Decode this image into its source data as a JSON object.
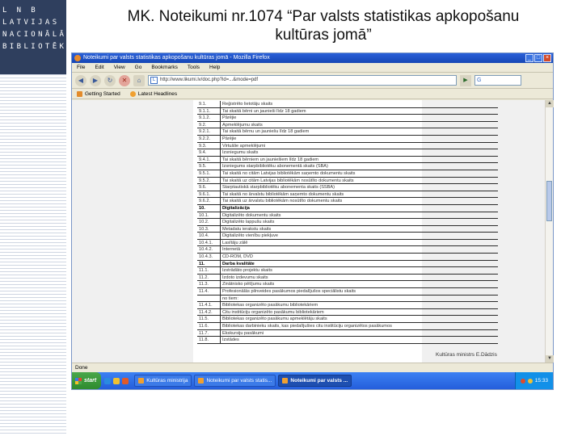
{
  "brand": {
    "lines": [
      "L N B",
      "LATVIJAS",
      "NACIONĀLĀ",
      "BIBLIOTĒKA"
    ]
  },
  "slide": {
    "title_line1": "MK. Noteikumi nr.1074 “Par valsts statistikas apkopošanu",
    "title_line2": "kultūras jomā”"
  },
  "browser": {
    "window_title": "Noteikumi par valsts statistikas apkopošanu kultūras jomā - Mozilla Firefox",
    "menu": [
      "File",
      "Edit",
      "View",
      "Go",
      "Bookmarks",
      "Tools",
      "Help"
    ],
    "url": "http://www.likumi.lv/doc.php?id=...&mode=pdf",
    "search_placeholder": "G",
    "bookmarks": [
      "Getting Started",
      "Latest Headlines"
    ],
    "status": "Done",
    "signature": "Kultūras ministrs E.Dādzis"
  },
  "table_rows": [
    {
      "num": "9.1.",
      "text": "Reģistrēto lietotāju skaits"
    },
    {
      "num": "9.1.1.",
      "text": "Tai skaitā bērni un jaunieši līdz 18 gadiem"
    },
    {
      "num": "9.1.2.",
      "text": "Pārējie"
    },
    {
      "num": "9.2.",
      "text": "Apmeklējumu skaits"
    },
    {
      "num": "9.2.1.",
      "text": "Tai skaitā bērnu un jauniešu līdz 18 gadiem"
    },
    {
      "num": "9.2.2.",
      "text": "Pārējie"
    },
    {
      "num": "9.3.",
      "text": "Virtuālie apmeklējumi"
    },
    {
      "num": "9.4.",
      "text": "Izsniegumu skaits"
    },
    {
      "num": "9.4.1.",
      "text": "Tai skaitā bērniem un jauniešiem līdz 18 gadiem"
    },
    {
      "num": "9.5.",
      "text": "Izsniegums starpbibliotēku abonementā skaits (SBA)"
    },
    {
      "num": "9.5.1.",
      "text": "Tai skaitā no citām Latvijas bibliotēkām saņemto dokumentu skaits"
    },
    {
      "num": "9.5.2.",
      "text": "Tai skaitā uz citām Latvijas bibliotēkām nosūtīto dokumentu skaits"
    },
    {
      "num": "9.6.",
      "text": "Starptautiskā starpbibliotēku abonementa skaits (SSBA)"
    },
    {
      "num": "9.6.1.",
      "text": "Tai skaitā no ārvalstu bibliotēkām saņemto dokumentu skaits"
    },
    {
      "num": "9.6.2.",
      "text": "Tai skaitā uz ārvalstu bibliotēkām nosūtīto dokumentu skaits"
    },
    {
      "num": "10.",
      "text": "Digitalizācija",
      "bold": true
    },
    {
      "num": "10.1.",
      "text": "Digitalizēto dokumentu skaits"
    },
    {
      "num": "10.2.",
      "text": "Digitalizēto lappušu skaits"
    },
    {
      "num": "10.3.",
      "text": "Metadatu ierakstu skaits"
    },
    {
      "num": "10.4.",
      "text": "Digitalizēto vienību piekļuve"
    },
    {
      "num": "10.4.1.",
      "text": "Lasītāju zālē"
    },
    {
      "num": "10.4.2.",
      "text": "Internetā"
    },
    {
      "num": "10.4.3.",
      "text": "CD-ROM, DVD"
    },
    {
      "num": "11.",
      "text": "Darba kvalitāte",
      "bold": true
    },
    {
      "num": "11.1.",
      "text": "Izstrādāto projektu skaits"
    },
    {
      "num": "11.2.",
      "text": "Izdoto izdevumu skaits"
    },
    {
      "num": "11.3.",
      "text": "Zinātnisko pētījumu skaits"
    },
    {
      "num": "11.4.",
      "text": "Profesionālās pilnveides pasākumos piedalījušos speciālistu skaits"
    },
    {
      "num": "",
      "text": "no tiem:"
    },
    {
      "num": "11.4.1.",
      "text": "Bibliotekas organizēto pasākumu bibliotekāriem"
    },
    {
      "num": "11.4.2.",
      "text": "Citu institūciju organizēto pasākumu bibliotekāriem"
    },
    {
      "num": "11.5.",
      "text": "Bibliotekas organizēto pasākumu apmeklētāju skaits"
    },
    {
      "num": "11.6.",
      "text": "Bibliotekas darbinieku skaits, kas piedalījušies citu institūciju organizētos pasākumos"
    },
    {
      "num": "11.7.",
      "text": "Ekskursiju pasākumi"
    },
    {
      "num": "11.8.",
      "text": "Izstādes"
    }
  ],
  "taskbar": {
    "start": "start",
    "tasks": [
      "Kultūras ministrija",
      "Noteikumi par valsts statis...",
      "Noteikumi par valsts ..."
    ],
    "clock": "15:33"
  }
}
